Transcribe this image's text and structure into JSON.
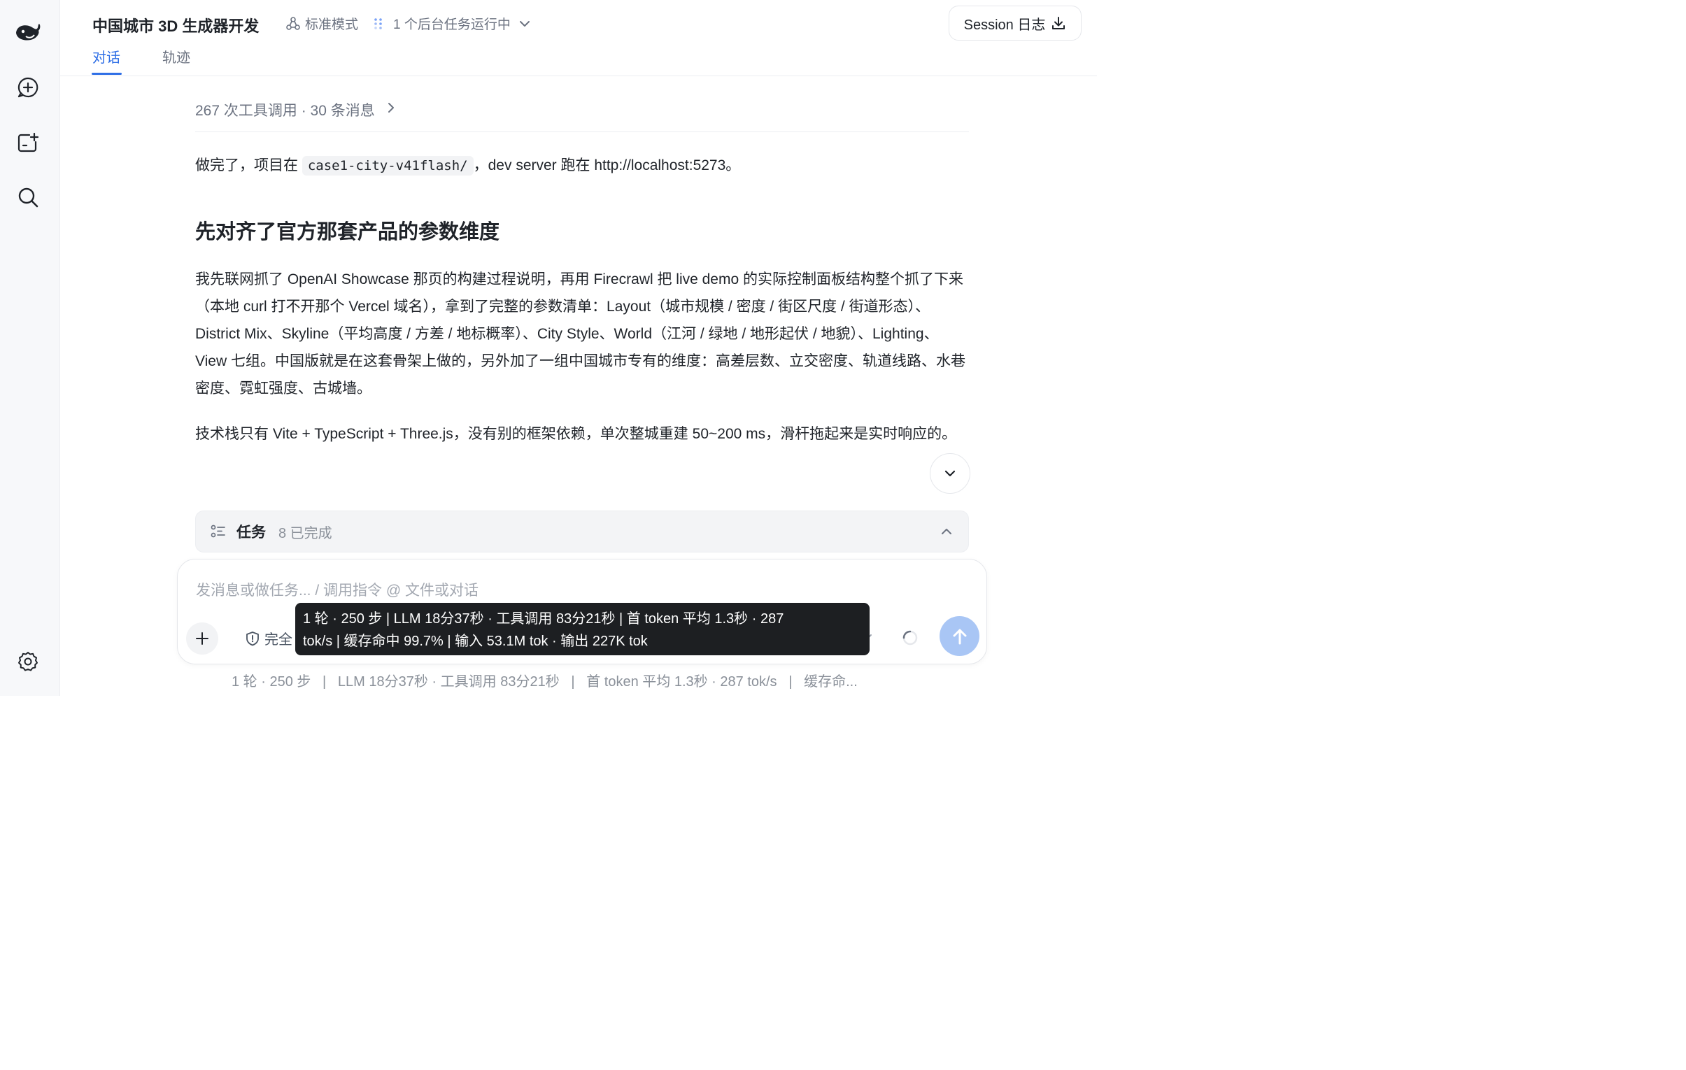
{
  "sidebar": {
    "icons": [
      "whale-logo-icon",
      "new-chat-icon",
      "new-project-icon",
      "search-icon",
      "settings-icon"
    ]
  },
  "header": {
    "title": "中国城市 3D 生成器开发",
    "mode_label": "标准模式",
    "background_tasks": "1 个后台任务运行中",
    "session_button": "Session 日志"
  },
  "tabs": [
    {
      "label": "对话",
      "active": true
    },
    {
      "label": "轨迹",
      "active": false
    }
  ],
  "conversation": {
    "summary": "267 次工具调用 · 30 条消息",
    "intro_before": "做完了，项目在 ",
    "intro_code": "case1-city-v41flash/",
    "intro_after": "，dev server 跑在 http://localhost:5273。",
    "heading": "先对齐了官方那套产品的参数维度",
    "paragraph1": "我先联网抓了 OpenAI Showcase 那页的构建过程说明，再用 Firecrawl 把 live demo 的实际控制面板结构整个抓了下来（本地 curl 打不开那个 Vercel 域名），拿到了完整的参数清单：Layout（城市规模 / 密度 / 街区尺度 / 街道形态）、District Mix、Skyline（平均高度 / 方差 / 地标概率）、City Style、World（江河 / 绿地 / 地形起伏 / 地貌）、Lighting、View 七组。中国版就是在这套骨架上做的，另外加了一组中国城市专有的维度：高差层数、立交密度、轨道线路、水巷密度、霓虹强度、古城墙。",
    "paragraph2": "技术栈只有 Vite + TypeScript + Three.js，没有别的框架依赖，单次整城重建 50~200 ms，滑杆拖起来是实时响应的。"
  },
  "tasks": {
    "label": "任务",
    "status": "8 已完成"
  },
  "composer": {
    "placeholder": "发消息或做任务... / 调用指令 @ 文件或对话",
    "permission_label": "完全"
  },
  "tooltip": {
    "line1": "1 轮 · 250 步 | LLM 18分37秒 · 工具调用 83分21秒 | 首 token 平均 1.3秒 · 287",
    "line2": "tok/s | 缓存命中 99.7% | 输入 53.1M tok · 输出 227K tok"
  },
  "footer": {
    "stats": "1 轮 · 250 步   |   LLM 18分37秒 · 工具调用 83分21秒   |   首 token 平均 1.3秒 · 287 tok/s   |   缓存命..."
  },
  "colors": {
    "accent": "#2f6fe6",
    "send_button": "#a9c6f5",
    "tooltip_bg": "#1d1f22"
  }
}
